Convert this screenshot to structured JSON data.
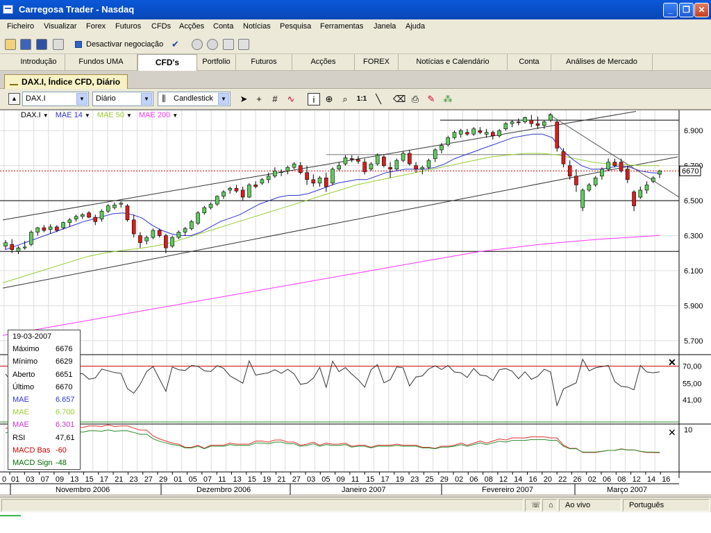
{
  "window": {
    "title": "Carregosa Trader - Nasdaq"
  },
  "menu": [
    "Ficheiro",
    "Visualizar",
    "Forex",
    "Futuros",
    "CFDs",
    "Acções",
    "Conta",
    "Notícias",
    "Pesquisa",
    "Ferramentas",
    "Janela",
    "Ajuda"
  ],
  "toolbar": {
    "deactivate_label": "Desactivar negociação"
  },
  "tabs": [
    "Introdução",
    "Fundos UMA",
    "CFD's",
    "Portfolio",
    "Futuros",
    "Acções",
    "FOREX",
    "Notícias e Calendário",
    "Conta",
    "Análises de Mercado"
  ],
  "active_tab": "CFD's",
  "doc_tab": "DAX.I, Índice CFD, Diário",
  "chart_toolbar": {
    "symbol": "DAX.I",
    "period": "Diário",
    "style": "Candlestick"
  },
  "legend": [
    {
      "label": "DAX.I",
      "color": "#000000"
    },
    {
      "label": "MAE 14",
      "color": "#3333cc"
    },
    {
      "label": "MAE 50",
      "color": "#99cc33"
    },
    {
      "label": "MAE 200",
      "color": "#ff33ff"
    }
  ],
  "price_axis": [
    "6.900",
    "6.700",
    "6.500",
    "6.300",
    "6.100",
    "5.900",
    "5.700"
  ],
  "last_price": "6670",
  "rsi_axis": [
    "70,00",
    "55,00",
    "41,00"
  ],
  "macd_axis": [
    "10"
  ],
  "dates": [
    "01",
    "03",
    "07",
    "09",
    "13",
    "15",
    "17",
    "21",
    "23",
    "27",
    "29",
    "01",
    "05",
    "07",
    "11",
    "13",
    "15",
    "19",
    "21",
    "27",
    "03",
    "05",
    "09",
    "11",
    "15",
    "17",
    "19",
    "23",
    "25",
    "29",
    "02",
    "06",
    "08",
    "12",
    "14",
    "16",
    "20",
    "22",
    "26",
    "02",
    "06",
    "08",
    "12",
    "14",
    "16"
  ],
  "day_zero": "0",
  "months": [
    "Novembro 2006",
    "Dezembro 2006",
    "Janeiro 2007",
    "Fevereiro 2007",
    "Março 2007"
  ],
  "info": [
    [
      "19-03-2007",
      ""
    ],
    [
      "Máximo",
      "6676"
    ],
    [
      "Mínimo",
      "6629"
    ],
    [
      "Aberto",
      "6651"
    ],
    [
      "Último",
      "6670"
    ],
    [
      "MAE",
      "6.657"
    ],
    [
      "MAE",
      "6.700"
    ],
    [
      "MAE",
      "6.301"
    ],
    [
      "RSI",
      "47,61"
    ],
    [
      "MACD Bas",
      "-60"
    ],
    [
      "MACD Sign",
      "-48"
    ]
  ],
  "info_colors": [
    "#000000",
    "#000000",
    "#000000",
    "#000000",
    "#000000",
    "#3333cc",
    "#99cc33",
    "#cc33cc",
    "#000000",
    "#cc0000",
    "#006600"
  ],
  "status": {
    "live": "Ao vivo",
    "language": "Português"
  },
  "chart_data": {
    "type": "candlestick",
    "ylim": [
      5620,
      7000
    ],
    "candles": [
      [
        6240,
        6275,
        6220,
        6260
      ],
      [
        6250,
        6280,
        6200,
        6220
      ],
      [
        6210,
        6240,
        6195,
        6230
      ],
      [
        6230,
        6270,
        6220,
        6235
      ],
      [
        6250,
        6330,
        6240,
        6320
      ],
      [
        6320,
        6350,
        6300,
        6345
      ],
      [
        6345,
        6360,
        6320,
        6330
      ],
      [
        6335,
        6365,
        6310,
        6350
      ],
      [
        6350,
        6360,
        6320,
        6330
      ],
      [
        6345,
        6380,
        6335,
        6375
      ],
      [
        6375,
        6400,
        6350,
        6390
      ],
      [
        6395,
        6420,
        6380,
        6410
      ],
      [
        6410,
        6430,
        6395,
        6420
      ],
      [
        6430,
        6440,
        6400,
        6405
      ],
      [
        6405,
        6420,
        6360,
        6380
      ],
      [
        6395,
        6450,
        6380,
        6440
      ],
      [
        6440,
        6480,
        6430,
        6470
      ],
      [
        6460,
        6490,
        6450,
        6475
      ],
      [
        6480,
        6495,
        6460,
        6485
      ],
      [
        6470,
        6480,
        6380,
        6390
      ],
      [
        6390,
        6420,
        6290,
        6310
      ],
      [
        6300,
        6320,
        6230,
        6260
      ],
      [
        6270,
        6300,
        6250,
        6290
      ],
      [
        6290,
        6340,
        6280,
        6330
      ],
      [
        6330,
        6340,
        6290,
        6300
      ],
      [
        6300,
        6310,
        6200,
        6230
      ],
      [
        6240,
        6300,
        6230,
        6290
      ],
      [
        6290,
        6330,
        6280,
        6320
      ],
      [
        6320,
        6350,
        6300,
        6340
      ],
      [
        6340,
        6390,
        6330,
        6380
      ],
      [
        6370,
        6440,
        6360,
        6430
      ],
      [
        6430,
        6470,
        6420,
        6460
      ],
      [
        6460,
        6490,
        6450,
        6480
      ],
      [
        6480,
        6530,
        6470,
        6525
      ],
      [
        6525,
        6560,
        6510,
        6550
      ],
      [
        6560,
        6580,
        6540,
        6570
      ],
      [
        6570,
        6590,
        6545,
        6555
      ],
      [
        6560,
        6580,
        6500,
        6520
      ],
      [
        6520,
        6600,
        6515,
        6590
      ],
      [
        6590,
        6610,
        6570,
        6580
      ],
      [
        6600,
        6630,
        6590,
        6620
      ],
      [
        6620,
        6660,
        6600,
        6640
      ],
      [
        6640,
        6690,
        6630,
        6670
      ],
      [
        6660,
        6680,
        6640,
        6665
      ],
      [
        6670,
        6700,
        6650,
        6690
      ],
      [
        6690,
        6720,
        6680,
        6710
      ],
      [
        6700,
        6720,
        6650,
        6660
      ],
      [
        6660,
        6700,
        6590,
        6620
      ],
      [
        6620,
        6650,
        6580,
        6600
      ],
      [
        6600,
        6640,
        6580,
        6630
      ],
      [
        6630,
        6660,
        6550,
        6580
      ],
      [
        6600,
        6690,
        6590,
        6680
      ],
      [
        6680,
        6720,
        6670,
        6700
      ],
      [
        6710,
        6760,
        6700,
        6745
      ],
      [
        6740,
        6760,
        6720,
        6735
      ],
      [
        6735,
        6755,
        6710,
        6725
      ],
      [
        6720,
        6740,
        6650,
        6665
      ],
      [
        6680,
        6720,
        6670,
        6710
      ],
      [
        6710,
        6770,
        6700,
        6760
      ],
      [
        6750,
        6760,
        6690,
        6700
      ],
      [
        6690,
        6720,
        6630,
        6680
      ],
      [
        6680,
        6740,
        6670,
        6730
      ],
      [
        6730,
        6780,
        6720,
        6770
      ],
      [
        6770,
        6790,
        6700,
        6710
      ],
      [
        6700,
        6720,
        6660,
        6680
      ],
      [
        6680,
        6700,
        6650,
        6690
      ],
      [
        6690,
        6740,
        6680,
        6730
      ],
      [
        6740,
        6800,
        6720,
        6790
      ],
      [
        6790,
        6830,
        6770,
        6815
      ],
      [
        6820,
        6870,
        6810,
        6860
      ],
      [
        6860,
        6900,
        6850,
        6890
      ],
      [
        6880,
        6910,
        6860,
        6900
      ],
      [
        6890,
        6910,
        6870,
        6880
      ],
      [
        6880,
        6920,
        6870,
        6910
      ],
      [
        6900,
        6920,
        6880,
        6890
      ],
      [
        6880,
        6910,
        6860,
        6890
      ],
      [
        6890,
        6900,
        6850,
        6870
      ],
      [
        6870,
        6910,
        6860,
        6900
      ],
      [
        6910,
        6950,
        6900,
        6940
      ],
      [
        6940,
        6960,
        6920,
        6950
      ],
      [
        6950,
        6970,
        6930,
        6945
      ],
      [
        6950,
        6980,
        6940,
        6975
      ],
      [
        6960,
        6990,
        6920,
        6940
      ],
      [
        6940,
        6980,
        6910,
        6930
      ],
      [
        6930,
        6960,
        6910,
        6950
      ],
      [
        6960,
        7000,
        6950,
        6990
      ],
      [
        6950,
        6960,
        6780,
        6800
      ],
      [
        6780,
        6800,
        6690,
        6710
      ],
      [
        6700,
        6730,
        6620,
        6640
      ],
      [
        6640,
        6680,
        6550,
        6590
      ],
      [
        6460,
        6570,
        6440,
        6560
      ],
      [
        6560,
        6600,
        6550,
        6590
      ],
      [
        6590,
        6640,
        6580,
        6630
      ],
      [
        6640,
        6690,
        6620,
        6680
      ],
      [
        6680,
        6740,
        6670,
        6720
      ],
      [
        6720,
        6740,
        6690,
        6700
      ],
      [
        6720,
        6740,
        6660,
        6670
      ],
      [
        6680,
        6700,
        6600,
        6620
      ],
      [
        6550,
        6560,
        6440,
        6470
      ],
      [
        6520,
        6580,
        6510,
        6560
      ],
      [
        6560,
        6610,
        6540,
        6590
      ],
      [
        6610,
        6640,
        6600,
        6630
      ],
      [
        6651,
        6676,
        6629,
        6670
      ]
    ],
    "mae14": [
      6220,
      6240,
      6260,
      6280,
      6300,
      6320,
      6340,
      6360,
      6380,
      6395,
      6410,
      6425,
      6430,
      6420,
      6400,
      6360,
      6330,
      6310,
      6300,
      6300,
      6320,
      6350,
      6380,
      6400,
      6420,
      6450,
      6480,
      6500,
      6520,
      6530,
      6530,
      6540,
      6560,
      6580,
      6600,
      6610,
      6620,
      6620,
      6640,
      6660,
      6670,
      6680,
      6680,
      6680,
      6690,
      6710,
      6740,
      6760,
      6780,
      6800,
      6820,
      6840,
      6860,
      6870,
      6880,
      6880,
      6860,
      6790,
      6740,
      6700,
      6680,
      6680,
      6690,
      6700,
      6690,
      6670,
      6660,
      6657
    ],
    "mae50": [
      6030,
      6060,
      6090,
      6120,
      6150,
      6180,
      6200,
      6215,
      6225,
      6240,
      6260,
      6290,
      6320,
      6350,
      6380,
      6410,
      6440,
      6470,
      6500,
      6530,
      6560,
      6590,
      6610,
      6630,
      6650,
      6670,
      6690,
      6710,
      6730,
      6750,
      6760,
      6770,
      6770,
      6760,
      6740,
      6720,
      6710,
      6705,
      6700,
      6700
    ],
    "mae200": [
      5730,
      5760,
      5790,
      5820,
      5850,
      5880,
      5910,
      5940,
      5970,
      6000,
      6030,
      6060,
      6090,
      6120,
      6150,
      6180,
      6210,
      6230,
      6250,
      6265,
      6280,
      6290,
      6301
    ]
  }
}
